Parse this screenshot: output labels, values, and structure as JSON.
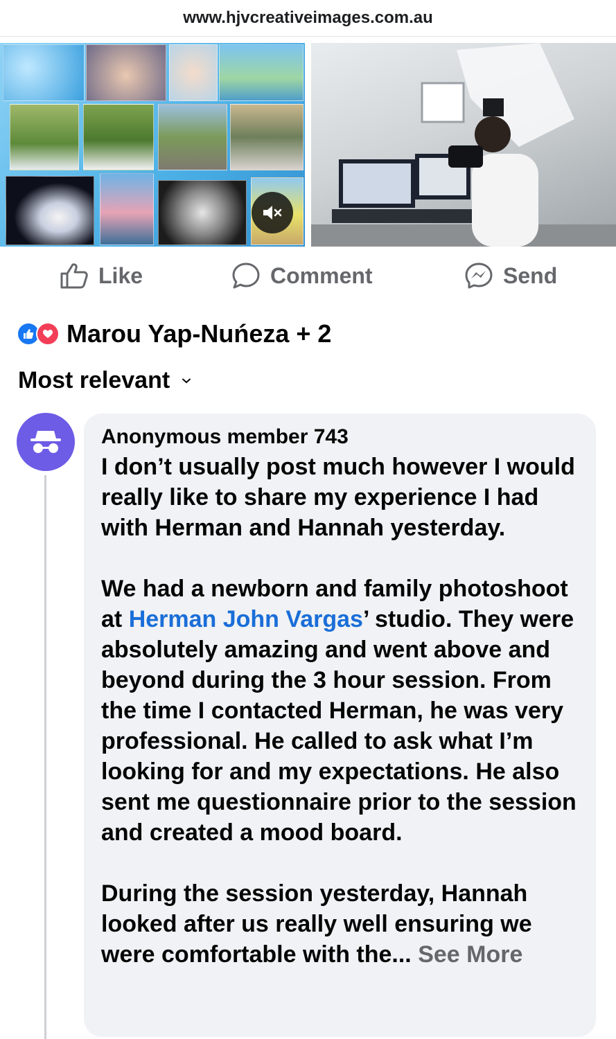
{
  "browser": {
    "url": "www.hjvcreativeimages.com.au"
  },
  "post": {
    "media": {
      "collage_icon": "photo-collage-image",
      "video_icon": "studio-video-thumbnail",
      "mute_icon": "speaker-muted-icon"
    },
    "actions": {
      "like_label": "Like",
      "comment_label": "Comment",
      "send_label": "Send"
    },
    "reactions": {
      "icons": [
        "like-reaction-icon",
        "love-reaction-icon"
      ],
      "text": "Marou Yap-Nuńeza + 2"
    },
    "sort": {
      "label": "Most relevant",
      "icon": "chevron-down-icon"
    }
  },
  "comment": {
    "avatar_icon": "incognito-icon",
    "author": "Anonymous member 743",
    "paragraph1": "I don’t usually post much however I would really like to share my experience I had with Herman and Hannah yesterday.",
    "paragraph2_before": "We had a newborn and family photoshoot at ",
    "mention": "Herman John Vargas",
    "paragraph2_after": "’ studio. They were absolutely amazing and went above and beyond during the 3 hour session. From the time I contacted Herman, he was very professional. He called to ask what I’m looking for and my expectations. He also sent me questionnaire prior to the session and created a mood board.",
    "paragraph3": "During the session yesterday, Hannah looked after us really well ensuring we were comfortable with the...",
    "see_more": "See More"
  },
  "colors": {
    "like_blue": "#1877f2",
    "love_red": "#f33e58",
    "mention_blue": "#1a6ed8",
    "avatar_purple": "#6d5ce6",
    "bubble_bg": "#f0f2f5",
    "muted_text": "#65676b"
  }
}
